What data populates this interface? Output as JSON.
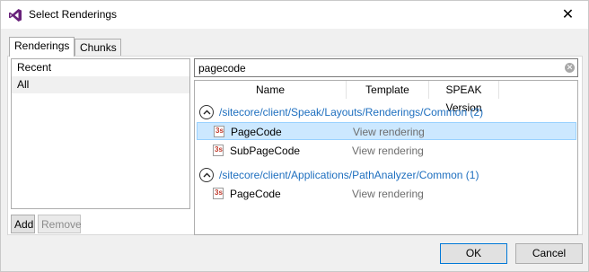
{
  "window": {
    "title": "Select Renderings"
  },
  "tabs": [
    {
      "label": "Renderings",
      "active": true
    },
    {
      "label": "Chunks",
      "active": false
    }
  ],
  "left_list": {
    "items": [
      {
        "label": "Recent",
        "selected": false
      },
      {
        "label": "All",
        "selected": true
      }
    ]
  },
  "left_buttons": {
    "add": "Add",
    "remove": "Remove"
  },
  "search": {
    "value": "pagecode"
  },
  "results": {
    "columns": [
      "Name",
      "Template",
      "SPEAK Version"
    ],
    "groups": [
      {
        "path": "/sitecore/client/Speak/Layouts/Renderings/Common (2)",
        "items": [
          {
            "name": "PageCode",
            "template": "View rendering",
            "selected": true
          },
          {
            "name": "SubPageCode",
            "template": "View rendering",
            "selected": false
          }
        ]
      },
      {
        "path": "/sitecore/client/Applications/PathAnalyzer/Common (1)",
        "items": [
          {
            "name": "PageCode",
            "template": "View rendering",
            "selected": false
          }
        ]
      }
    ]
  },
  "buttons": {
    "ok": "OK",
    "cancel": "Cancel"
  },
  "colors": {
    "accent": "#0078d7",
    "link": "#1e6fbf",
    "selection": "#cce8ff"
  }
}
